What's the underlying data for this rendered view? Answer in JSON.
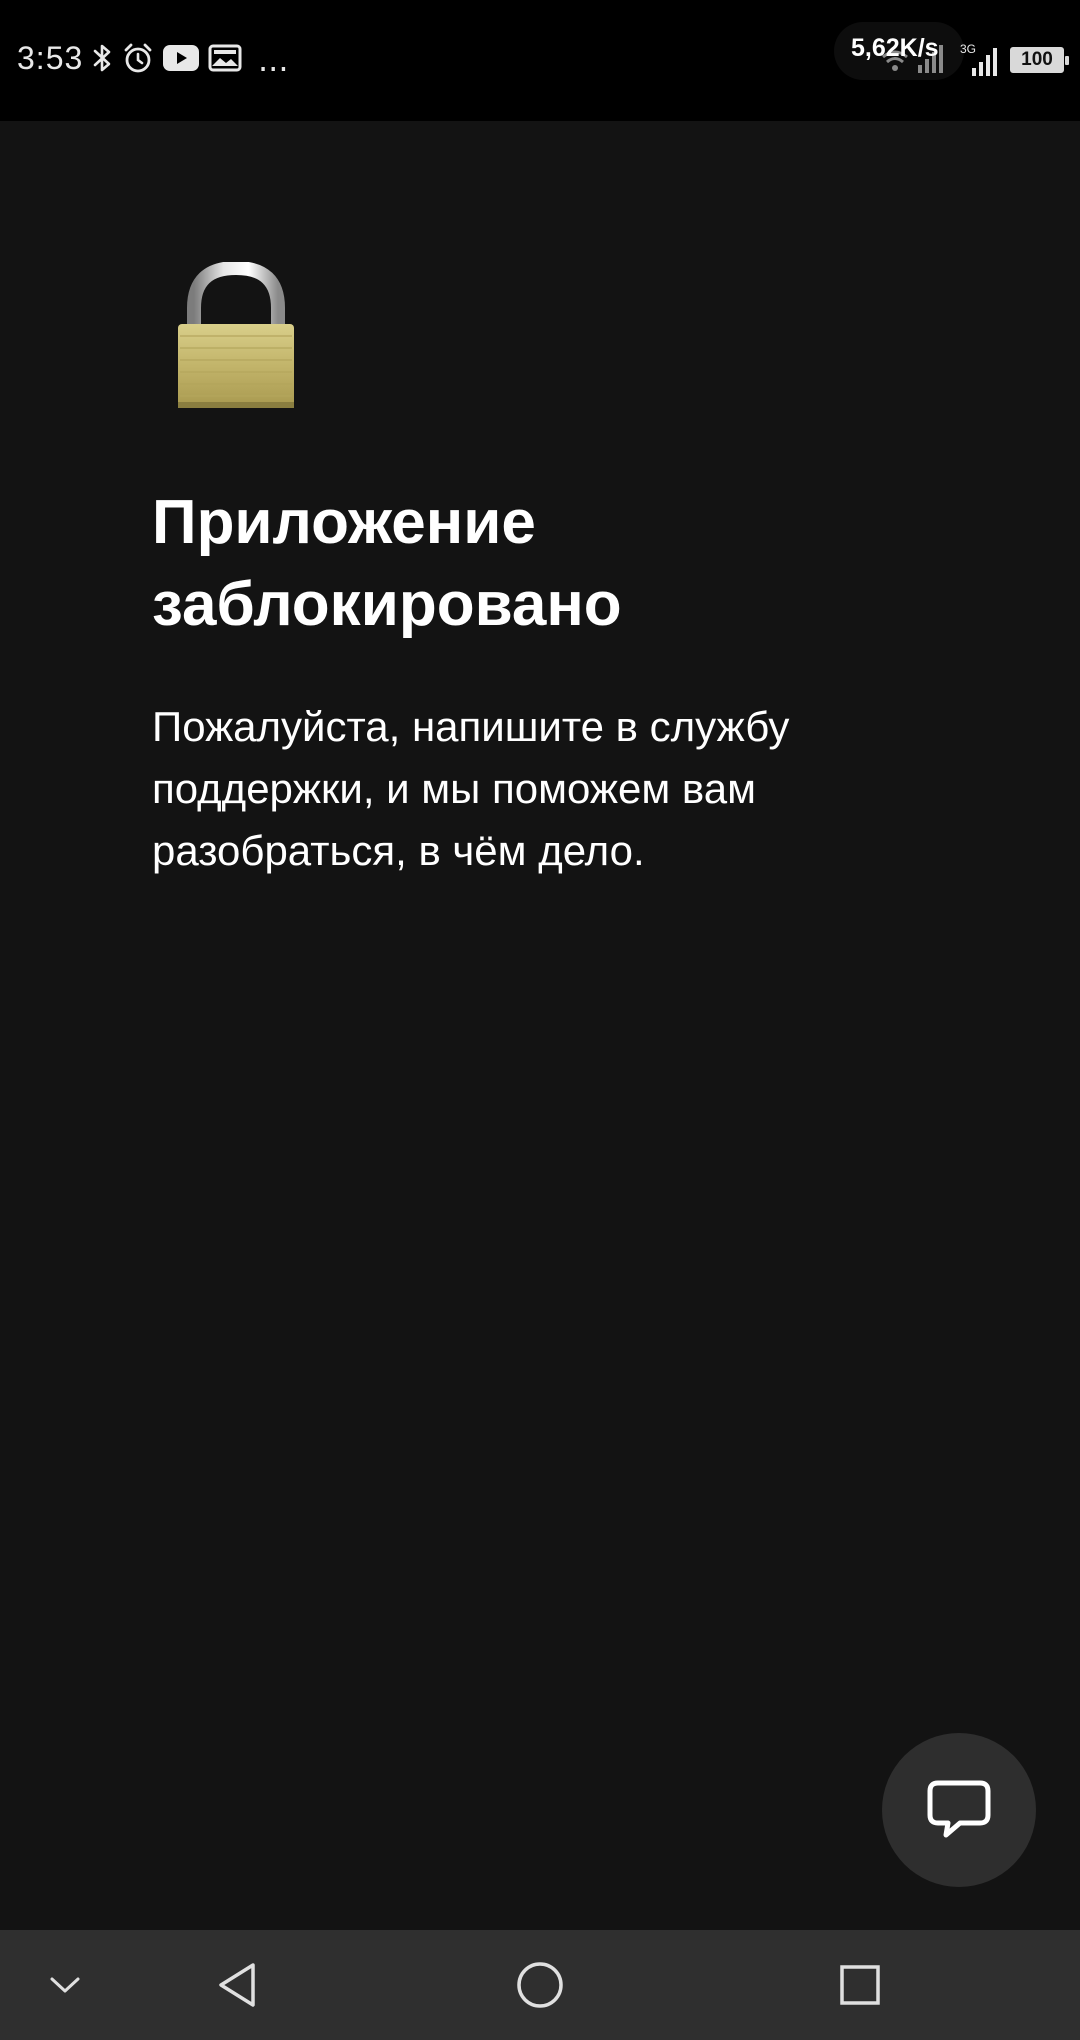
{
  "status_bar": {
    "time": "3:53",
    "net_speed": "5,62K/s",
    "network_type": "3G",
    "battery": "100",
    "more": "...",
    "icons_left": [
      "bluetooth-icon",
      "alarm-icon",
      "youtube-icon",
      "image-icon"
    ],
    "icons_right": [
      "wifi-icon",
      "signal-icon",
      "signal-icon"
    ]
  },
  "blocked_screen": {
    "icon": "padlock-icon",
    "title": "Приложение заблокировано",
    "message": "Пожалуйста, напишите в службу поддержки, и мы поможем вам разобраться, в чём дело."
  },
  "chat_fab": {
    "icon": "chat-bubble-icon"
  },
  "nav_bar": {
    "items": [
      "chevron-down-icon",
      "back-icon",
      "home-icon",
      "recents-icon"
    ]
  },
  "colors": {
    "background": "#131313",
    "status_bar": "#000000",
    "nav_bar": "#2f2f2f",
    "fab": "#2e2e2e",
    "text": "#ffffff"
  }
}
